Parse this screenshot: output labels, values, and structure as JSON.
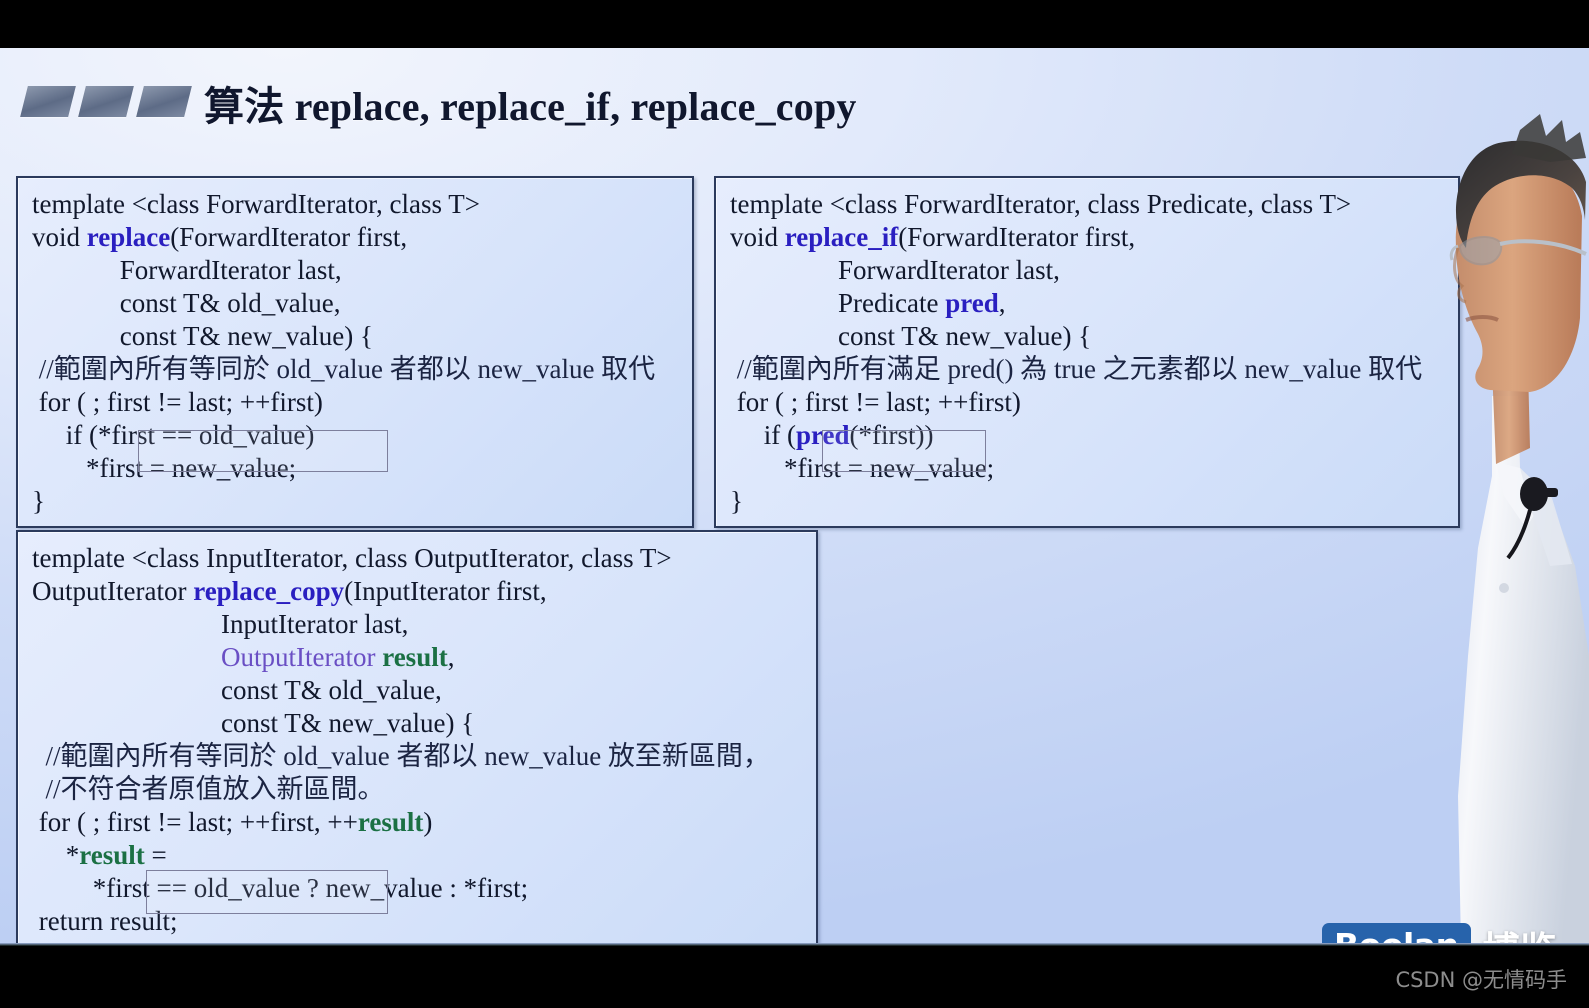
{
  "slide": {
    "title": "算法 replace, replace_if, replace_copy",
    "decoration": "three-parallelogram-bullets"
  },
  "code_blocks": [
    {
      "id": "replace",
      "name": "replace",
      "lines": [
        "template <class ForwardIterator, class T>",
        "void replace(ForwardIterator first,",
        "             ForwardIterator last,",
        "             const T& old_value,",
        "             const T& new_value) {",
        " //範圍內所有等同於 old_value 者都以 new_value 取代",
        " for ( ; first != last; ++first)",
        "     if (*first == old_value)",
        "        *first = new_value;",
        "}"
      ],
      "keyword": "replace",
      "highlighted_line": "if (*first == old_value)"
    },
    {
      "id": "replace_if",
      "name": "replace_if",
      "lines": [
        "template <class ForwardIterator, class Predicate, class T>",
        "void replace_if(ForwardIterator first,",
        "                ForwardIterator last,",
        "                Predicate pred,",
        "                const T& new_value) {",
        " //範圍內所有滿足 pred() 為 true 之元素都以 new_value 取代",
        " for ( ; first != last; ++first)",
        "     if (pred(*first))",
        "        *first = new_value;",
        "}"
      ],
      "keyword": "replace_if",
      "parameter_keyword": "pred",
      "highlighted_line": "if (pred(*first))"
    },
    {
      "id": "replace_copy",
      "name": "replace_copy",
      "lines": [
        "template <class InputIterator, class OutputIterator, class T>",
        "OutputIterator replace_copy(InputIterator first,",
        "                            InputIterator last,",
        "                            OutputIterator result,",
        "                            const T& old_value,",
        "                            const T& new_value) {",
        "  //範圍內所有等同於 old_value 者都以 new_value 放至新區間，",
        "  //不符合者原值放入新區間。",
        " for ( ; first != last; ++first, ++result)",
        "     *result =",
        "         *first == old_value ? new_value : *first;",
        " return result;",
        " }"
      ],
      "keyword": "replace_copy",
      "type_keyword": "OutputIterator",
      "result_keyword": "result",
      "highlighted_line": "*first == old_value ?"
    }
  ],
  "watermark": {
    "brand": "Boolan",
    "brand_cn": "博览"
  },
  "credit": {
    "text": "CSDN @无情码手"
  },
  "colors": {
    "keyword_blue": "#2a1fc0",
    "result_green": "#1b7044",
    "output_purple": "#6a4fc4",
    "title_navy": "#10172e",
    "box_border": "#2b3a5c",
    "boolan_blue": "#2763ab",
    "slide_bg": "#dbe6fb",
    "letterbox": "#000000",
    "credit_gray": "#8d8d8d"
  }
}
